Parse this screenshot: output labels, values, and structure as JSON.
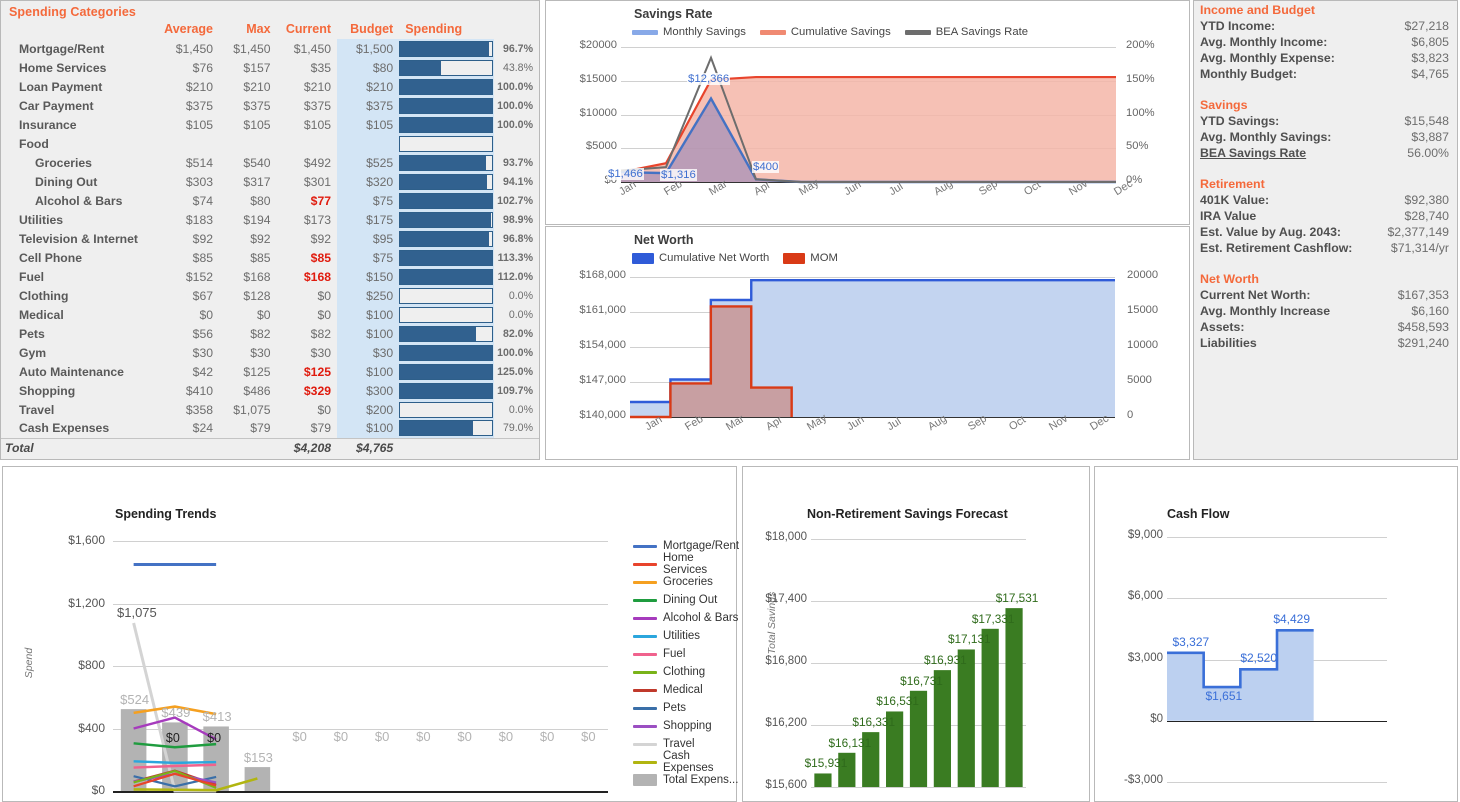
{
  "spending": {
    "title": "Spending Categories",
    "columns": [
      "",
      "Average",
      "Max",
      "Current",
      "Budget",
      "Spending",
      ""
    ],
    "rows": [
      {
        "category": "Mortgage/Rent",
        "sub": false,
        "average": "$1,450",
        "max": "$1,450",
        "current": "$1,450",
        "budget": "$1,500",
        "pct": "96.7%",
        "pct_val": 96.7,
        "pct_color": "orange",
        "over": false
      },
      {
        "category": "Home Services",
        "sub": false,
        "average": "$76",
        "max": "$157",
        "current": "$35",
        "budget": "$80",
        "pct": "43.8%",
        "pct_val": 43.8,
        "pct_color": "grey",
        "over": false
      },
      {
        "category": "Loan Payment",
        "sub": false,
        "average": "$210",
        "max": "$210",
        "current": "$210",
        "budget": "$210",
        "pct": "100.0%",
        "pct_val": 100.0,
        "pct_color": "red",
        "over": false
      },
      {
        "category": "Car Payment",
        "sub": false,
        "average": "$375",
        "max": "$375",
        "current": "$375",
        "budget": "$375",
        "pct": "100.0%",
        "pct_val": 100.0,
        "pct_color": "red",
        "over": false
      },
      {
        "category": "Insurance",
        "sub": false,
        "average": "$105",
        "max": "$105",
        "current": "$105",
        "budget": "$105",
        "pct": "100.0%",
        "pct_val": 100.0,
        "pct_color": "red",
        "over": false
      },
      {
        "category": "Food",
        "sub": false,
        "average": "",
        "max": "",
        "current": "",
        "budget": "",
        "pct": "",
        "pct_val": 0,
        "pct_color": "grey",
        "over": false,
        "header": true
      },
      {
        "category": "Groceries",
        "sub": true,
        "average": "$514",
        "max": "$540",
        "current": "$492",
        "budget": "$525",
        "pct": "93.7%",
        "pct_val": 93.7,
        "pct_color": "orange",
        "over": false
      },
      {
        "category": "Dining Out",
        "sub": true,
        "average": "$303",
        "max": "$317",
        "current": "$301",
        "budget": "$320",
        "pct": "94.1%",
        "pct_val": 94.1,
        "pct_color": "orange",
        "over": false
      },
      {
        "category": "Alcohol & Bars",
        "sub": true,
        "average": "$74",
        "max": "$80",
        "current": "$77",
        "budget": "$75",
        "pct": "102.7%",
        "pct_val": 102.7,
        "pct_color": "red",
        "over": true
      },
      {
        "category": "Utilities",
        "sub": false,
        "average": "$183",
        "max": "$194",
        "current": "$173",
        "budget": "$175",
        "pct": "98.9%",
        "pct_val": 98.9,
        "pct_color": "orange",
        "over": false
      },
      {
        "category": "Television & Internet",
        "sub": false,
        "average": "$92",
        "max": "$92",
        "current": "$92",
        "budget": "$95",
        "pct": "96.8%",
        "pct_val": 96.8,
        "pct_color": "orange",
        "over": false
      },
      {
        "category": "Cell Phone",
        "sub": false,
        "average": "$85",
        "max": "$85",
        "current": "$85",
        "budget": "$75",
        "pct": "113.3%",
        "pct_val": 113.3,
        "pct_color": "red",
        "over": true
      },
      {
        "category": "Fuel",
        "sub": false,
        "average": "$152",
        "max": "$168",
        "current": "$168",
        "budget": "$150",
        "pct": "112.0%",
        "pct_val": 112.0,
        "pct_color": "red",
        "over": true
      },
      {
        "category": "Clothing",
        "sub": false,
        "average": "$67",
        "max": "$128",
        "current": "$0",
        "budget": "$250",
        "pct": "0.0%",
        "pct_val": 0.0,
        "pct_color": "grey",
        "over": false
      },
      {
        "category": "Medical",
        "sub": false,
        "average": "$0",
        "max": "$0",
        "current": "$0",
        "budget": "$100",
        "pct": "0.0%",
        "pct_val": 0.0,
        "pct_color": "grey",
        "over": false
      },
      {
        "category": "Pets",
        "sub": false,
        "average": "$56",
        "max": "$82",
        "current": "$82",
        "budget": "$100",
        "pct": "82.0%",
        "pct_val": 82.0,
        "pct_color": "orange",
        "over": false
      },
      {
        "category": "Gym",
        "sub": false,
        "average": "$30",
        "max": "$30",
        "current": "$30",
        "budget": "$30",
        "pct": "100.0%",
        "pct_val": 100.0,
        "pct_color": "red",
        "over": false
      },
      {
        "category": "Auto Maintenance",
        "sub": false,
        "average": "$42",
        "max": "$125",
        "current": "$125",
        "budget": "$100",
        "pct": "125.0%",
        "pct_val": 125.0,
        "pct_color": "red",
        "over": true
      },
      {
        "category": "Shopping",
        "sub": false,
        "average": "$410",
        "max": "$486",
        "current": "$329",
        "budget": "$300",
        "pct": "109.7%",
        "pct_val": 109.7,
        "pct_color": "red",
        "over": true
      },
      {
        "category": "Travel",
        "sub": false,
        "average": "$358",
        "max": "$1,075",
        "current": "$0",
        "budget": "$200",
        "pct": "0.0%",
        "pct_val": 0.0,
        "pct_color": "grey",
        "over": false
      },
      {
        "category": "Cash Expenses",
        "sub": false,
        "average": "$24",
        "max": "$79",
        "current": "$79",
        "budget": "$100",
        "pct": "79.0%",
        "pct_val": 79.0,
        "pct_color": "grey",
        "over": false
      }
    ],
    "total": {
      "label": "Total",
      "current": "$4,208",
      "budget": "$4,765"
    }
  },
  "summary": {
    "sections": [
      {
        "heading": "Income and Budget",
        "rows": [
          {
            "key": "YTD Income:",
            "value": "$27,218"
          },
          {
            "key": "Avg. Monthly Income:",
            "value": "$6,805"
          },
          {
            "key": "Avg. Monthly Expense:",
            "value": "$3,823"
          },
          {
            "key": "Monthly Budget:",
            "value": "$4,765"
          }
        ]
      },
      {
        "heading": "Savings",
        "rows": [
          {
            "key": "YTD Savings:",
            "value": "$15,548"
          },
          {
            "key": "Avg. Monthly Savings:",
            "value": "$3,887"
          },
          {
            "key": "BEA Savings Rate",
            "value": "56.00%",
            "underline": true
          }
        ]
      },
      {
        "heading": "Retirement",
        "rows": [
          {
            "key": "401K Value:",
            "value": "$92,380"
          },
          {
            "key": "IRA Value",
            "value": "$28,740"
          },
          {
            "key": "Est. Value by Aug. 2043:",
            "value": "$2,377,149"
          },
          {
            "key": "Est. Retirement Cashflow:",
            "value": "$71,314/yr"
          }
        ]
      },
      {
        "heading": "Net Worth",
        "rows": [
          {
            "key": "Current Net Worth:",
            "value": "$167,353"
          },
          {
            "key": "Avg. Monthly Increase",
            "value": "$6,160"
          },
          {
            "key": "Assets:",
            "value": "$458,593"
          },
          {
            "key": "Liabilities",
            "value": "$291,240"
          }
        ]
      }
    ]
  },
  "chart_data": [
    {
      "id": "savings_rate",
      "type": "line",
      "title": "Savings Rate",
      "xlabel": "",
      "ylabel": "",
      "categories": [
        "Jan",
        "Feb",
        "Mar",
        "Apr",
        "May",
        "Jun",
        "Jul",
        "Aug",
        "Sep",
        "Oct",
        "Nov",
        "Dec"
      ],
      "ylim": [
        0,
        20000
      ],
      "yticks": [
        "$0",
        "$5000",
        "$10000",
        "$15000",
        "$20000"
      ],
      "y2lim": [
        0,
        200
      ],
      "y2ticks": [
        "0%",
        "50%",
        "100%",
        "150%",
        "200%"
      ],
      "grid": true,
      "legend_position": "top",
      "series": [
        {
          "name": "Monthly Savings",
          "color": "#4472c4",
          "values": [
            1466,
            1316,
            12366,
            400,
            0,
            0,
            0,
            0,
            0,
            0,
            0,
            0
          ],
          "labels": [
            "$1,466",
            "$1,316",
            "$12,366",
            "$400",
            "",
            "",
            "",
            "",
            "",
            "",
            "",
            ""
          ]
        },
        {
          "name": "Cumulative Savings",
          "color": "#e8442c",
          "values": [
            1466,
            2782,
            15148,
            15548,
            15548,
            15548,
            15548,
            15548,
            15548,
            15548,
            15548,
            15548
          ],
          "labels": []
        },
        {
          "name": "BEA Savings Rate",
          "color": "#6d6d6d",
          "axis": "y2",
          "values": [
            17,
            22,
            184,
            4,
            0,
            0,
            0,
            0,
            0,
            0,
            0,
            0
          ],
          "labels": []
        }
      ]
    },
    {
      "id": "net_worth",
      "type": "area",
      "title": "Net Worth",
      "categories": [
        "Jan",
        "Feb",
        "Mar",
        "Apr",
        "May",
        "Jun",
        "Jul",
        "Aug",
        "Sep",
        "Oct",
        "Nov",
        "Dec"
      ],
      "ylim": [
        140000,
        168000
      ],
      "yticks": [
        "$140,000",
        "$147,000",
        "$154,000",
        "$161,000",
        "$168,000"
      ],
      "y2lim": [
        0,
        20000
      ],
      "y2ticks": [
        "0",
        "5000",
        "10000",
        "15000",
        "20000"
      ],
      "grid": true,
      "legend_position": "top",
      "series": [
        {
          "name": "Cumulative Net Worth",
          "color": "#2f5bd8",
          "values": [
            143000,
            147500,
            163400,
            167353,
            167353,
            167353,
            167353,
            167353,
            167353,
            167353,
            167353,
            167353
          ]
        },
        {
          "name": "MOM",
          "color": "#d93a16",
          "axis": "y2",
          "values": [
            0,
            4800,
            15800,
            4200,
            0,
            0,
            0,
            0,
            0,
            0,
            0,
            0
          ]
        }
      ]
    },
    {
      "id": "spending_trends",
      "type": "line",
      "title": "Spending Trends",
      "ylabel": "Spend",
      "ylim": [
        0,
        1600
      ],
      "yticks": [
        "$0",
        "$400",
        "$800",
        "$1,200",
        "$1,600"
      ],
      "grid": true,
      "legend_position": "right",
      "bar_series": {
        "name": "Total Expens...",
        "color": "#b3b3b3",
        "values": [
          524,
          439,
          413,
          153,
          0,
          0,
          0,
          0,
          0,
          0,
          0,
          0
        ],
        "labels": [
          "$524",
          "$439",
          "$413",
          "$153",
          "$0",
          "$0",
          "$0",
          "$0",
          "$0",
          "$0",
          "$0",
          "$0"
        ]
      },
      "inner_labels": [
        "$0",
        "$0"
      ],
      "top_label": "$1,075",
      "legend": [
        {
          "name": "Mortgage/Rent",
          "color": "#4472c4"
        },
        {
          "name": "Home Services",
          "color": "#e8442c"
        },
        {
          "name": "Groceries",
          "color": "#f5a020"
        },
        {
          "name": "Dining Out",
          "color": "#1f9c3f"
        },
        {
          "name": "Alcohol & Bars",
          "color": "#a63bbd"
        },
        {
          "name": "Utilities",
          "color": "#2ba6dd"
        },
        {
          "name": "Fuel",
          "color": "#f0628d"
        },
        {
          "name": "Clothing",
          "color": "#79b319"
        },
        {
          "name": "Medical",
          "color": "#c0392b"
        },
        {
          "name": "Pets",
          "color": "#3a6fa8"
        },
        {
          "name": "Shopping",
          "color": "#9b4fc2"
        },
        {
          "name": "Travel",
          "color": "#d4d4d4"
        },
        {
          "name": "Cash Expenses",
          "color": "#b1b510"
        },
        {
          "name": "Total Expens...",
          "color": "#b3b3b3"
        }
      ]
    },
    {
      "id": "savings_forecast",
      "type": "bar",
      "title": "Non-Retirement Savings Forecast",
      "ylabel": "Total Savings",
      "ylim": [
        15600,
        18000
      ],
      "yticks": [
        "$15,600",
        "$16,200",
        "$16,800",
        "$17,400",
        "$18,000"
      ],
      "grid": true,
      "bar_color": "#3a7c22",
      "values": [
        15731,
        15931,
        16131,
        16331,
        16531,
        16731,
        16931,
        17131,
        17331
      ],
      "labels": [
        "",
        "$15,931",
        "$16,131",
        "$16,331",
        "$16,531",
        "$16,731",
        "$16,931",
        "$17,131",
        "$17,331",
        "$17,531"
      ],
      "displayed_labels": [
        "$15,931",
        "$16,131",
        "$16,331",
        "$16,531",
        "$16,731",
        "$16,931",
        "$17,131",
        "$17,331",
        "$17,531"
      ]
    },
    {
      "id": "cash_flow",
      "type": "area",
      "title": "Cash Flow",
      "ylim": [
        -3000,
        9000
      ],
      "yticks": [
        "-$3,000",
        "$0",
        "$3,000",
        "$6,000",
        "$9,000"
      ],
      "grid": true,
      "line_color": "#3a6fd8",
      "fill_color": "#bcd0f0",
      "values": [
        3327,
        1651,
        2520,
        4429,
        0,
        0
      ],
      "labels": [
        "$3,327",
        "$1,651",
        "$2,520",
        "$4,429"
      ]
    }
  ]
}
